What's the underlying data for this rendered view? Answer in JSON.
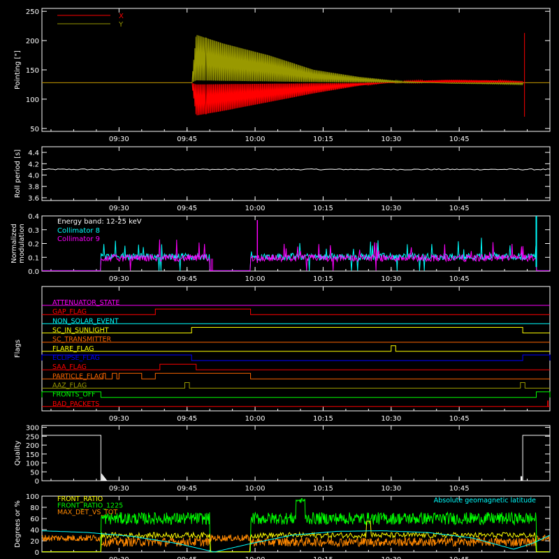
{
  "chart_data": [
    {
      "type": "line",
      "id": "pointing",
      "ylabel": "Pointing [\"]",
      "ylim": [
        45,
        255
      ],
      "yticks": [
        50,
        100,
        150,
        200,
        250
      ],
      "xticks": [
        "09:30",
        "09:45",
        "10:00",
        "10:15",
        "10:30",
        "10:45"
      ],
      "legend": "top-left",
      "series": [
        {
          "name": "X",
          "color": "#ff0000",
          "baseline": 128,
          "envelope_start_min": 33,
          "envelope_end_min": 106,
          "points": [
            [
              0,
              128
            ],
            [
              33,
              128
            ],
            [
              34,
              72
            ],
            [
              40,
              80
            ],
            [
              50,
              95
            ],
            [
              60,
              110
            ],
            [
              70,
              123
            ],
            [
              80,
              131
            ],
            [
              90,
              133
            ],
            [
              100,
              132
            ],
            [
              106,
              130
            ],
            [
              107,
              128
            ],
            [
              112,
              128
            ]
          ]
        },
        {
          "name": "Y",
          "color": "#999900",
          "baseline": 128,
          "envelope_start_min": 33,
          "envelope_end_min": 106,
          "points": [
            [
              0,
              128
            ],
            [
              33,
              128
            ],
            [
              34,
              210
            ],
            [
              40,
              195
            ],
            [
              50,
              175
            ],
            [
              60,
              150
            ],
            [
              70,
              138
            ],
            [
              80,
              130
            ],
            [
              90,
              127
            ],
            [
              100,
              126
            ],
            [
              106,
              125
            ],
            [
              107,
              128
            ],
            [
              112,
              128
            ]
          ]
        }
      ]
    },
    {
      "type": "line",
      "id": "roll",
      "ylabel": "Roll period [s]",
      "ylim": [
        3.55,
        4.5
      ],
      "yticks": [
        3.6,
        3.8,
        4.0,
        4.2,
        4.4
      ],
      "xticks": [
        "09:30",
        "09:45",
        "10:00",
        "10:15",
        "10:30",
        "10:45"
      ],
      "series": [
        {
          "name": "",
          "color": "#ffffff",
          "value": 4.1
        }
      ]
    },
    {
      "type": "line",
      "id": "modulation",
      "ylabel": "Normalized modulation",
      "ylim": [
        0,
        0.4
      ],
      "yticks": [
        0.0,
        0.1,
        0.2,
        0.3,
        0.4
      ],
      "xticks": [
        "09:30",
        "09:45",
        "10:00",
        "10:15",
        "10:30",
        "10:45"
      ],
      "annotation": "Energy band: 12-25 keV",
      "legend": "top-left",
      "active_intervals_min": [
        [
          13,
          37
        ],
        [
          46,
          95
        ],
        [
          95,
          109
        ]
      ],
      "series": [
        {
          "name": "Collimator 8",
          "color": "#00ffff",
          "typical": 0.1
        },
        {
          "name": "Collimator 9",
          "color": "#ff00ff",
          "typical": 0.09
        }
      ]
    },
    {
      "type": "line",
      "id": "flags",
      "ylabel": "Flags",
      "xticks": [
        "09:30",
        "09:45",
        "10:00",
        "10:15",
        "10:30",
        "10:45"
      ],
      "series": [
        {
          "name": "ATTENUATOR_STATE",
          "color": "#ff00ff",
          "high": []
        },
        {
          "name": "GAP_FLAG",
          "color": "#ff0000",
          "high": [
            [
              25,
              46
            ]
          ]
        },
        {
          "name": "NON_SOLAR_EVENT",
          "color": "#00ffff",
          "high": []
        },
        {
          "name": "SC_IN_SUNLIGHT",
          "color": "#ffff00",
          "high": [
            [
              33,
              106
            ]
          ]
        },
        {
          "name": "SC_TRANSMITTER",
          "color": "#ff6600",
          "high": []
        },
        {
          "name": "FLARE_FLAG",
          "color": "#ffff00",
          "high": [
            [
              77,
              78
            ]
          ]
        },
        {
          "name": "ECLIPSE_FLAG",
          "color": "#0000ff",
          "high": [
            [
              0,
              33
            ],
            [
              106,
              112
            ]
          ]
        },
        {
          "name": "SAA_FLAG",
          "color": "#ff0000",
          "high": [
            [
              26,
              34
            ]
          ]
        },
        {
          "name": "PARTICLE_FLAG",
          "color": "#ff6600",
          "high": [
            [
              13.5,
              14
            ],
            [
              15.5,
              16.5
            ],
            [
              17,
              22
            ],
            [
              25,
              46
            ]
          ]
        },
        {
          "name": "AAZ_FLAG",
          "color": "#999900",
          "high": [
            [
              31.5,
              32.5
            ],
            [
              105.5,
              106.5
            ]
          ]
        },
        {
          "name": "FRONTS_OFF",
          "color": "#00ff00",
          "high": [
            [
              0,
              13
            ],
            [
              109,
              112
            ]
          ]
        },
        {
          "name": "BAD_PACKETS",
          "color": "#ff0000",
          "high": [
            [
              111.5,
              111.6
            ]
          ]
        }
      ]
    },
    {
      "type": "line",
      "id": "quality",
      "ylabel": "Quality",
      "ylim": [
        0,
        310
      ],
      "yticks": [
        0,
        50,
        100,
        150,
        200,
        250,
        300
      ],
      "xticks": [
        "09:30",
        "09:45",
        "10:00",
        "10:15",
        "10:30",
        "10:45"
      ],
      "series": [
        {
          "name": "",
          "color": "#ffffff",
          "points": [
            [
              0,
              255
            ],
            [
              13,
              255
            ],
            [
              13,
              0
            ],
            [
              106,
              0
            ],
            [
              106,
              255
            ],
            [
              112,
              255
            ]
          ]
        }
      ]
    },
    {
      "type": "line",
      "id": "front",
      "ylabel": "Degrees or %",
      "ylim": [
        0,
        100
      ],
      "yticks": [
        0,
        20,
        40,
        60,
        80,
        100
      ],
      "xticks": [
        "09:30",
        "09:45",
        "10:00",
        "10:15",
        "10:30",
        "10:45"
      ],
      "legend": "top-left",
      "series": [
        {
          "name": "FRONT_RATIO",
          "color": "#ffff00",
          "typical": 30
        },
        {
          "name": "FRONT_RATIO_1225",
          "color": "#00ff00",
          "typical": 60
        },
        {
          "name": "MAX_DET_VS_TOT",
          "color": "#ff8800",
          "typical": 18
        },
        {
          "name": "Absolute geomagnetic latitude",
          "color": "#00ffff",
          "points": [
            [
              0,
              38
            ],
            [
              10,
              35
            ],
            [
              20,
              28
            ],
            [
              30,
              15
            ],
            [
              38,
              0
            ],
            [
              46,
              15
            ],
            [
              55,
              30
            ],
            [
              65,
              37
            ],
            [
              75,
              38
            ],
            [
              85,
              35
            ],
            [
              95,
              25
            ],
            [
              104,
              5
            ],
            [
              108,
              15
            ],
            [
              112,
              30
            ]
          ]
        }
      ]
    }
  ]
}
